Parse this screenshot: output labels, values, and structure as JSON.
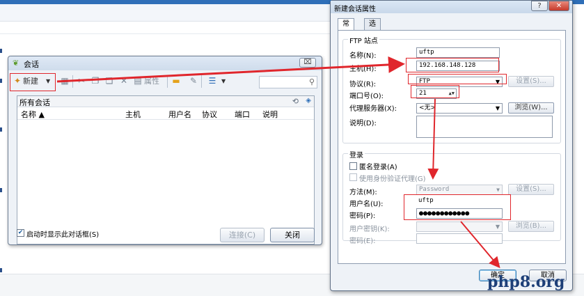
{
  "session_dialog": {
    "title": "会话",
    "close_glyph": "⌧",
    "toolbar": {
      "new_label": "新建",
      "properties_label": "属性",
      "search_glyph": "⚲"
    },
    "list_title": "所有会话",
    "columns": [
      "名称 ▲",
      "主机",
      "用户名",
      "协议",
      "端口",
      "说明"
    ],
    "show_on_startup_label": "启动时显示此对话框(S)",
    "show_on_startup_checked": true,
    "connect_label": "连接(C)",
    "close_label": "关闭"
  },
  "properties_dialog": {
    "title": "新建会话属性",
    "help_glyph": "?",
    "close_glyph": "✕",
    "tabs": [
      "常规",
      "选项"
    ],
    "active_tab": "常规",
    "ftp_site": {
      "group_label": "FTP 站点",
      "name_label": "名称(N):",
      "name_value": "uftp",
      "host_label": "主机(H):",
      "host_value": "192.168.148.128",
      "protocol_label": "协议(R):",
      "protocol_value": "FTP",
      "settings_label": "设置(S)...",
      "port_label": "端口号(O):",
      "port_value": "21",
      "proxy_label": "代理服务器(X):",
      "proxy_value": "<无>",
      "browse_label": "浏览(W)...",
      "desc_label": "说明(D):",
      "desc_value": ""
    },
    "login": {
      "group_label": "登录",
      "anonymous_label": "匿名登录(A)",
      "use_agent_label": "使用身份验证代理(G)",
      "method_label": "方法(M):",
      "method_value": "Password",
      "method_settings_label": "设置(S)...",
      "username_label": "用户名(U):",
      "username_value": "uftp",
      "password_label": "密码(P):",
      "password_value": "●●●●●●●●●●●●",
      "keyfile_label": "用户密钥(K):",
      "keyfile_browse_label": "浏览(B)...",
      "passphrase_label": "密码(E):"
    },
    "ok_label": "确定",
    "cancel_label": "取消"
  },
  "watermark": "php8.org",
  "colors": {
    "annotation_red": "#e0262c",
    "title_blue": "#2f6fb8"
  }
}
